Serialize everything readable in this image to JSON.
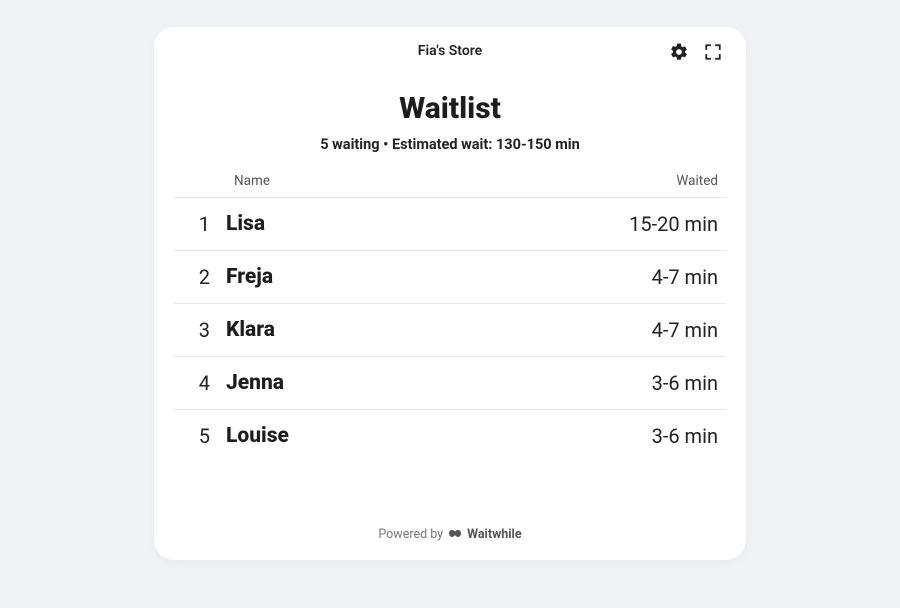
{
  "header": {
    "store_name": "Fia's Store"
  },
  "main": {
    "title": "Waitlist",
    "subtitle": "5 waiting • Estimated wait: 130-150 min",
    "columns": {
      "name": "Name",
      "waited": "Waited"
    },
    "rows": [
      {
        "index": "1",
        "name": "Lisa",
        "waited": "15-20 min"
      },
      {
        "index": "2",
        "name": "Freja",
        "waited": "4-7 min"
      },
      {
        "index": "3",
        "name": "Klara",
        "waited": "4-7 min"
      },
      {
        "index": "4",
        "name": "Jenna",
        "waited": "3-6 min"
      },
      {
        "index": "5",
        "name": "Louise",
        "waited": "3-6 min"
      }
    ]
  },
  "footer": {
    "prefix": "Powered by",
    "brand": "Waitwhile"
  }
}
